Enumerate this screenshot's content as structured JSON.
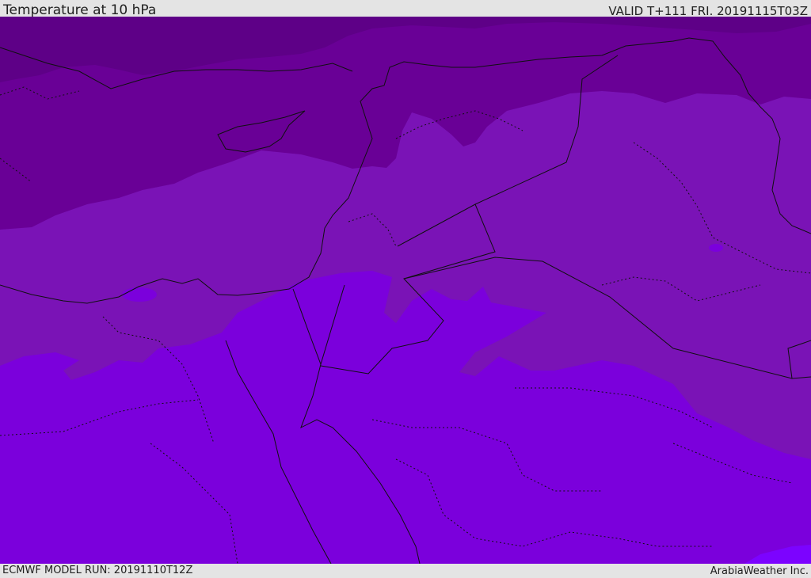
{
  "header": {
    "title": "Temperature at 10 hPa",
    "valid": "VALID T+111 FRI. 20191115T03Z"
  },
  "footer": {
    "model_run": "ECMWF MODEL RUN: 20191110T12Z",
    "credit": "ArabiaWeather Inc."
  },
  "map": {
    "field": "temperature",
    "level": "10 hPa",
    "colors": {
      "coldest": "#5e0087",
      "cold": "#690096",
      "mid": "#7a13b6",
      "warm": "#7b00dc",
      "warmest": "#7c03ff",
      "coastline": "#101010"
    }
  }
}
